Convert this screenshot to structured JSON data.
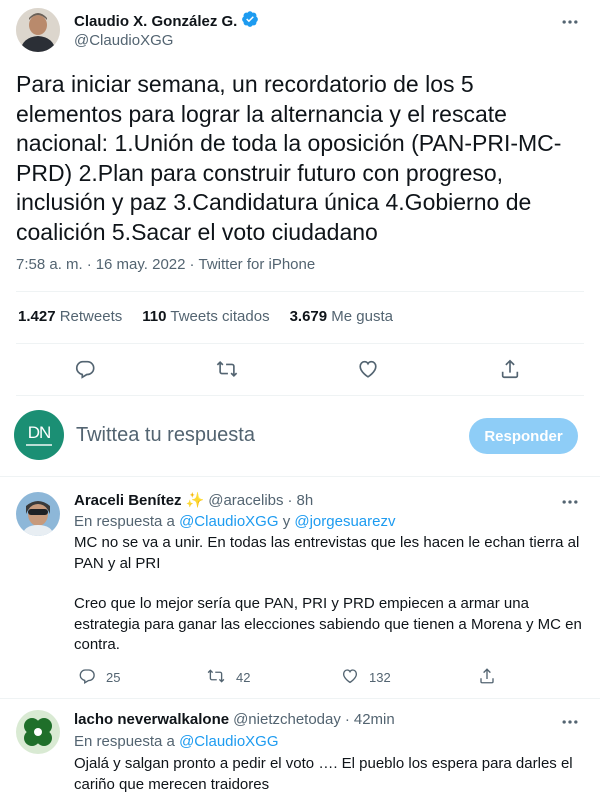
{
  "main_tweet": {
    "author_name": "Claudio X. González G.",
    "author_handle": "@ClaudioXGG",
    "text": "Para iniciar semana, un recordatorio de los 5 elementos para lograr la alternancia y el rescate nacional: 1.Unión de toda la oposición (PAN-PRI-MC-PRD) 2.Plan para construir futuro con progreso, inclusión y paz 3.Candidatura única 4.Gobierno de coalición 5.Sacar el voto ciudadano",
    "time": "7:58 a. m.",
    "sep": "·",
    "date": "16 may. 2022",
    "source": "Twitter for iPhone",
    "stats": {
      "retweets_count": "1.427",
      "retweets_label": "Retweets",
      "quotes_count": "110",
      "quotes_label": "Tweets citados",
      "likes_count": "3.679",
      "likes_label": "Me gusta"
    }
  },
  "compose": {
    "avatar_text": "DN",
    "placeholder": "Twittea tu respuesta",
    "button_label": "Responder"
  },
  "replies": [
    {
      "name": "Araceli Benítez",
      "emoji": "✨",
      "handle": "@aracelibs",
      "time": "8h",
      "reply_prefix": "En respuesta a",
      "reply_to_1": "@ClaudioXGG",
      "reply_join": "y",
      "reply_to_2": "@jorgesuarezv",
      "text_p1": "MC no se va a unir. En todas las entrevistas que les hacen le echan tierra al PAN y al PRI",
      "text_p2": "Creo que lo mejor sería que PAN, PRI y PRD empiecen a armar una estrategia para ganar las elecciones sabiendo que tienen a Morena y MC en contra.",
      "replies_count": "25",
      "retweets_count": "42",
      "likes_count": "132"
    },
    {
      "name": "lacho neverwalkalone",
      "handle": "@nietzchetoday",
      "time": "42min",
      "reply_prefix": "En respuesta a",
      "reply_to_1": "@ClaudioXGG",
      "text_p1": "Ojalá y salgan pronto a pedir el voto …. El pueblo los espera para darles el cariño que merecen traidores"
    }
  ],
  "colors": {
    "accent": "#1d9bf0",
    "muted": "#536471",
    "button_disabled": "#8ecdf7",
    "verified": "#1d9bf0"
  },
  "icons": [
    "more-icon",
    "verified-badge-icon",
    "reply-icon",
    "retweet-icon",
    "like-icon",
    "share-icon"
  ]
}
